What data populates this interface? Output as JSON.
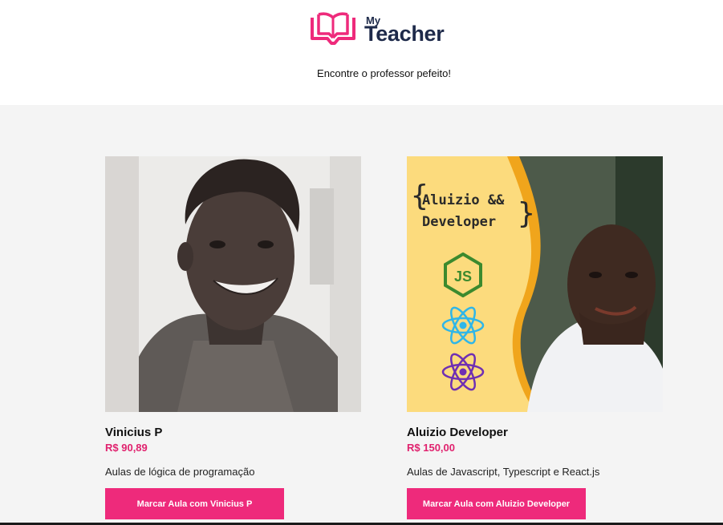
{
  "brand": {
    "my": "My",
    "teacher": "Teacher",
    "logo_icon": "open-book-icon",
    "primary_color": "#ee2a7b",
    "dark_color": "#1e2a4a"
  },
  "tagline": "Encontre o professor pefeito!",
  "teachers": [
    {
      "name": "Vinicius P",
      "price": "R$ 90,89",
      "description": "Aulas de lógica de programação",
      "button_label": "Marcar Aula com Vinicius P"
    },
    {
      "name": "Aluizio Developer",
      "price": "R$ 150,00",
      "description": "Aulas de Javascript, Typescript e React.js",
      "button_label": "Marcar Aula com Aluizio Developer",
      "banner": {
        "line1": "Aluizio &&",
        "line2": "Developer",
        "icons": [
          "nodejs-icon",
          "react-icon",
          "redux-icon"
        ],
        "js_label": "JS"
      }
    }
  ]
}
